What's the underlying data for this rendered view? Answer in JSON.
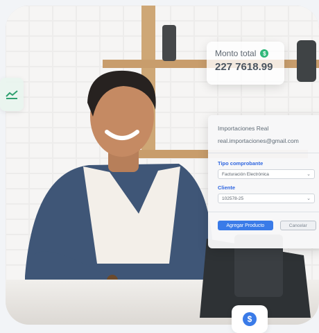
{
  "total": {
    "label": "Monto total",
    "value": "227 7618.99",
    "icon": "dollar-icon",
    "icon_color": "#2fb87a"
  },
  "customer": {
    "name": "Importaciones Real",
    "email": "real.importaciones@gmail.com"
  },
  "form": {
    "voucher_type_label": "Tipo comprobante",
    "voucher_type_value": "Facturación Electrónica",
    "client_label": "Cliente",
    "client_value": "102578-25",
    "add_button": "Agregar Producto",
    "cancel_button": "Cancelar"
  },
  "chips": {
    "left_icon": "trend-chart-icon",
    "bottom_icon": "dollar-icon"
  },
  "colors": {
    "accent_blue": "#3a7be8",
    "label_blue": "#2f66e0",
    "success_green": "#2fb87a"
  }
}
